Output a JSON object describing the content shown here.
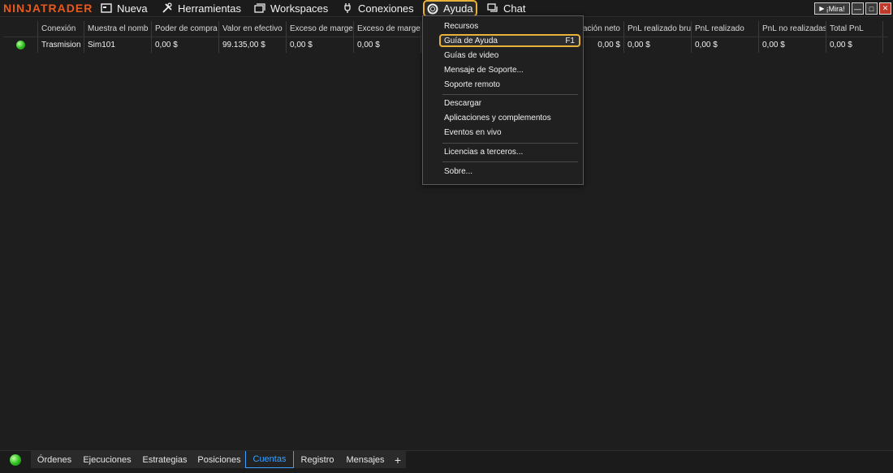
{
  "app": {
    "logo": "NINJATRADER"
  },
  "menu": {
    "nueva": "Nueva",
    "herramientas": "Herramientas",
    "workspaces": "Workspaces",
    "conexiones": "Conexiones",
    "ayuda": "Ayuda",
    "chat": "Chat"
  },
  "window": {
    "mira": "¡Mira!"
  },
  "grid": {
    "headers": [
      "Conexión",
      "Muestra el nomb",
      "Poder de compra",
      "Valor en efectivo",
      "Exceso de marge",
      "Exceso de marge",
      "ación neto",
      "PnL realizado bru",
      "PnL realizado",
      "PnL no realizadas",
      "Total PnL"
    ],
    "row": [
      "Trasmision",
      "Sim101",
      "0,00 $",
      "99.135,00 $",
      "0,00 $",
      "0,00 $",
      "0,00 $",
      "0,00 $",
      "0,00 $",
      "0,00 $",
      "0,00 $"
    ]
  },
  "ayuda_menu": {
    "recursos": "Recursos",
    "guia_ayuda": "Guía de Ayuda",
    "guia_shortcut": "F1",
    "guias_video": "Guías de video",
    "mensaje_soporte": "Mensaje de Soporte...",
    "soporte_remoto": "Soporte remoto",
    "descargar": "Descargar",
    "aplicaciones": "Aplicaciones y complementos",
    "eventos": "Eventos en vivo",
    "licencias": "Licencias a terceros...",
    "sobre": "Sobre..."
  },
  "tabs": [
    "Órdenes",
    "Ejecuciones",
    "Estrategias",
    "Posiciones",
    "Cuentas",
    "Registro",
    "Mensajes",
    "+"
  ],
  "active_tab": "Cuentas",
  "colors": {
    "accent": "#e8b23a",
    "logo": "#e65a1e",
    "tab_active": "#3aa0ff",
    "status_ok": "#2bbd1d"
  }
}
